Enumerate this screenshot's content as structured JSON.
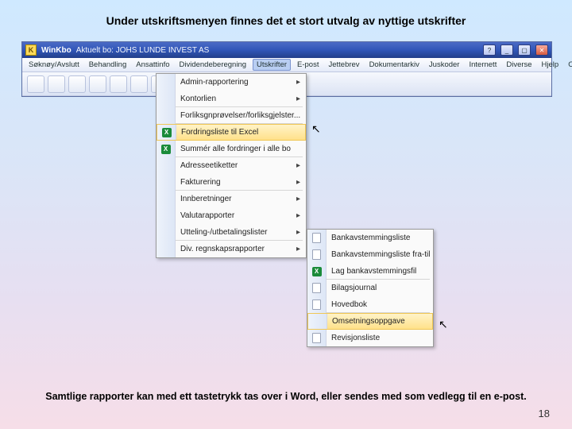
{
  "slide": {
    "title": "Under utskriftsmenyen finnes det et stort utvalg av nyttige utskrifter",
    "caption": "Samtlige rapporter kan med ett tastetrykk tas over i Word, eller sendes med som vedlegg til en e-post.",
    "page": "18"
  },
  "window": {
    "app": "WinKbo",
    "sub": "Aktuelt bo: JOHS LUNDE INVEST AS"
  },
  "menubar": {
    "items": [
      "Søknøy/Avslutt",
      "Behandling",
      "Ansattinfo",
      "Dividendeberegning",
      "Utskrifter",
      "E-post",
      "Jettebrev",
      "Dokumentarkiv",
      "Juskoder",
      "Internett",
      "Diverse",
      "Hjelp",
      "Om Winkbo"
    ],
    "active_index": 4
  },
  "dropdown": {
    "items": [
      {
        "label": "Admin-rapportering",
        "submenu": true
      },
      {
        "label": "Kontorlien",
        "submenu": true,
        "sep": true
      },
      {
        "label": "Forliksgnprøvelser/forliksgjelster...",
        "sep": true
      },
      {
        "label": "Fordringsliste til Excel",
        "icon": "excel",
        "highlight": true
      },
      {
        "label": "Summér alle fordringer i alle bo",
        "icon": "excel",
        "sep": true
      },
      {
        "label": "Adresseetiketter",
        "submenu": true
      },
      {
        "label": "Fakturering",
        "submenu": true,
        "sep": true
      },
      {
        "label": "Innberetninger",
        "submenu": true
      },
      {
        "label": "Valutarapporter",
        "submenu": true
      },
      {
        "label": "Utteling-/utbetalingslister",
        "submenu": true,
        "sep": true
      },
      {
        "label": "Div. regnskapsrapporter",
        "submenu": true
      }
    ]
  },
  "submenu": {
    "items": [
      {
        "label": "Bankavstemmingsliste",
        "icon": "doc"
      },
      {
        "label": "Bankavstemmingsliste fra-til dato",
        "icon": "doc"
      },
      {
        "label": "Lag bankavstemmingsfil",
        "icon": "excel",
        "sep": true
      },
      {
        "label": "Bilagsjournal",
        "icon": "doc"
      },
      {
        "label": "Hovedbok",
        "icon": "doc",
        "sep": true
      },
      {
        "label": "Omsetningsoppgave",
        "highlight": true
      },
      {
        "label": "Revisjonsliste",
        "icon": "doc"
      }
    ]
  }
}
